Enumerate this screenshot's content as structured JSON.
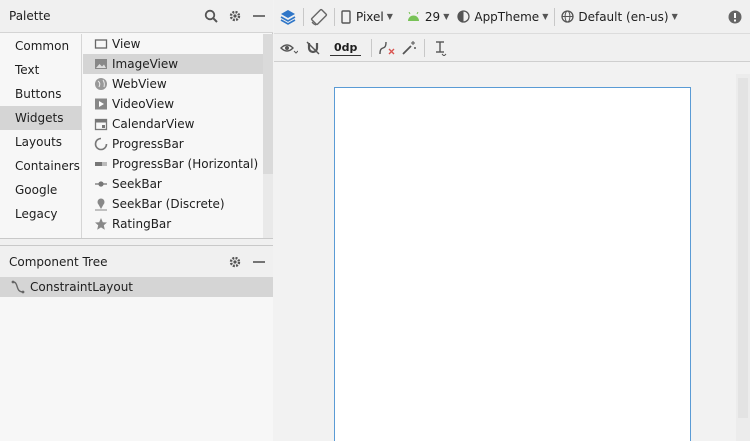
{
  "palette": {
    "title": "Palette",
    "categories": [
      "Common",
      "Text",
      "Buttons",
      "Widgets",
      "Layouts",
      "Containers",
      "Google",
      "Legacy"
    ],
    "selected_category": "Widgets",
    "widgets": [
      {
        "label": "View",
        "icon": "view-icon"
      },
      {
        "label": "ImageView",
        "icon": "image-icon"
      },
      {
        "label": "WebView",
        "icon": "globe-icon"
      },
      {
        "label": "VideoView",
        "icon": "video-icon"
      },
      {
        "label": "CalendarView",
        "icon": "calendar-icon"
      },
      {
        "label": "ProgressBar",
        "icon": "progress-circle-icon"
      },
      {
        "label": "ProgressBar (Horizontal)",
        "icon": "progress-bar-icon"
      },
      {
        "label": "SeekBar",
        "icon": "seekbar-icon"
      },
      {
        "label": "SeekBar (Discrete)",
        "icon": "seekbar-discrete-icon"
      },
      {
        "label": "RatingBar",
        "icon": "star-icon"
      }
    ],
    "selected_widget": "ImageView"
  },
  "component_tree": {
    "title": "Component Tree",
    "root": "ConstraintLayout"
  },
  "toolbar": {
    "device": "Pixel",
    "api": "29",
    "theme": "AppTheme",
    "locale": "Default (en-us)",
    "margin": "0dp"
  },
  "colors": {
    "accent_blue": "#2f76c8",
    "android_green": "#78c257",
    "selection": "#d5d5d5",
    "device_border": "#5a9bd5"
  }
}
